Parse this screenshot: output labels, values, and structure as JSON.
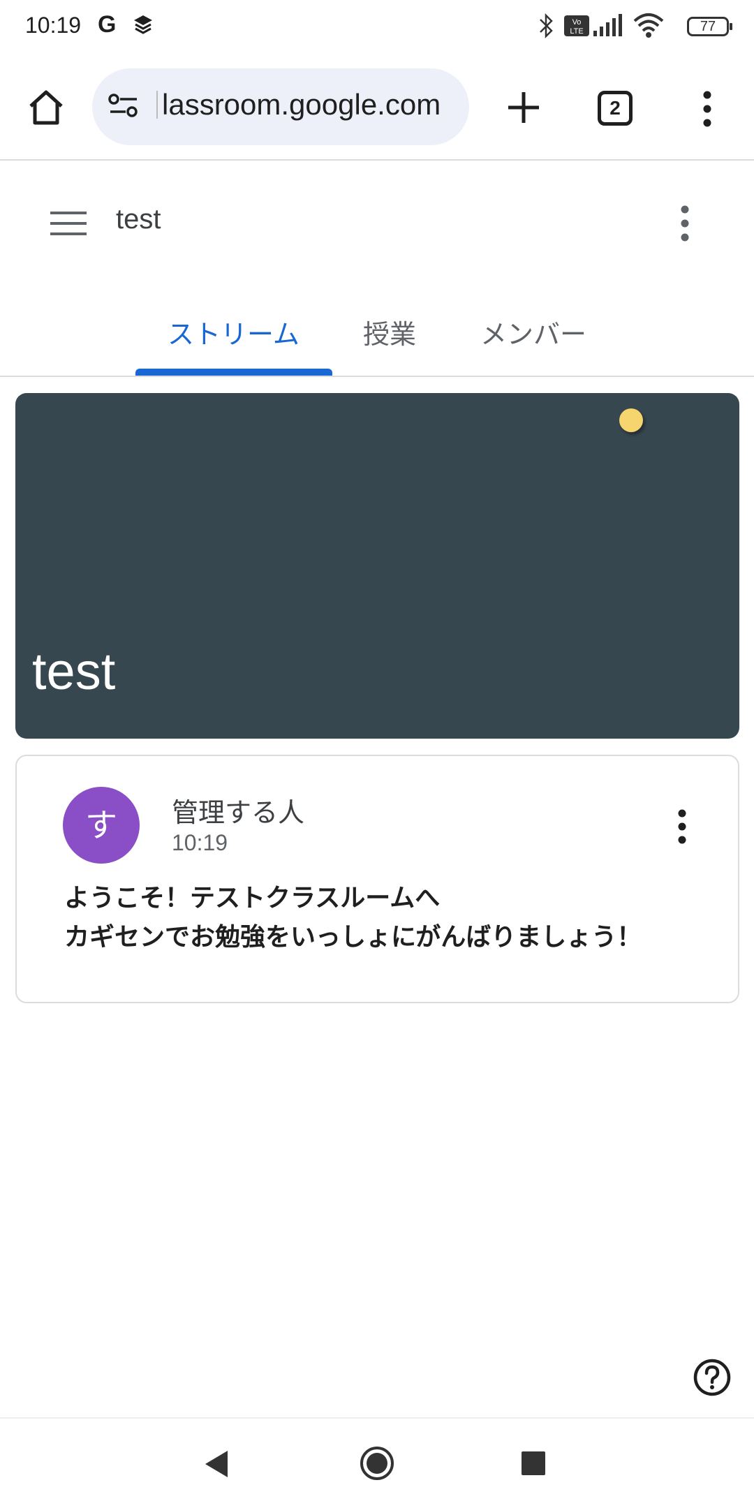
{
  "status_bar": {
    "time": "10:19",
    "g_label": "G",
    "battery": "77",
    "icons": [
      "google-g-icon",
      "layers-icon",
      "bluetooth-icon",
      "volte-icon",
      "signal-icon",
      "wifi-icon",
      "battery-icon"
    ]
  },
  "browser": {
    "url": "lassroom.google.com",
    "tab_count": "2",
    "icons": [
      "home-icon",
      "site-settings-icon",
      "plus-icon",
      "more-vert-icon"
    ]
  },
  "app": {
    "title": "test",
    "tabs": [
      {
        "label": "ストリーム",
        "active": true
      },
      {
        "label": "授業",
        "active": false
      },
      {
        "label": "メンバー",
        "active": false
      }
    ]
  },
  "banner": {
    "title": "test",
    "color": "#37474f"
  },
  "post": {
    "avatar_letter": "す",
    "avatar_color": "#8a4fc7",
    "author": "管理する人",
    "time": "10:19",
    "lines": [
      "ようこそ！テストクラスルームへ",
      "カギセンでお勉強をいっしょにがんばりましょう！"
    ]
  },
  "accent_color": "#1967d2",
  "nav": {
    "icons": [
      "back-icon",
      "home-circle-icon",
      "recents-icon"
    ]
  }
}
